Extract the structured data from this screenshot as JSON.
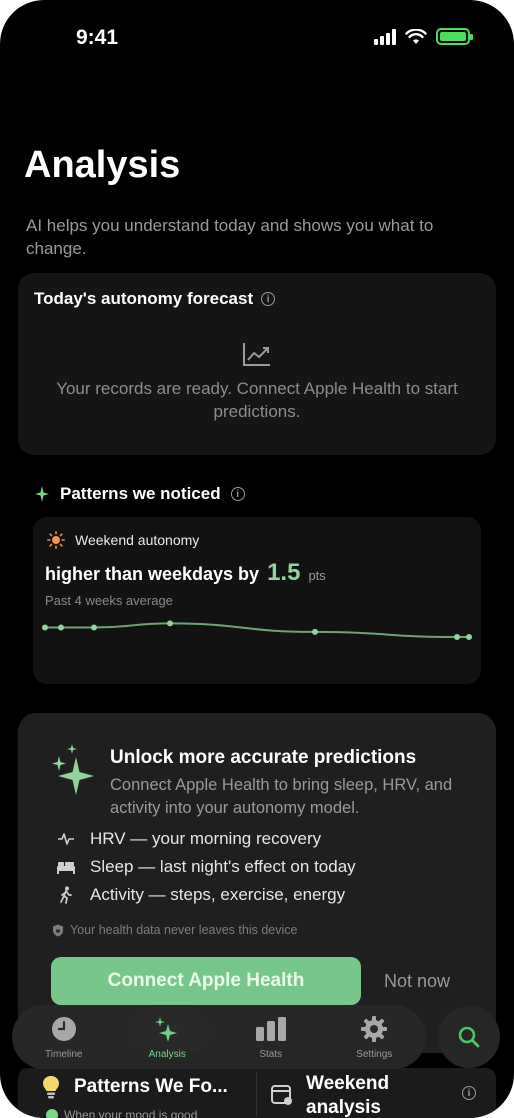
{
  "status_bar": {
    "time": "9:41"
  },
  "header": {
    "title": "Analysis",
    "subtitle": "AI helps you understand today and shows you what to change."
  },
  "forecast_card": {
    "title": "Today's autonomy forecast",
    "message": "Your records are ready. Connect Apple Health to start predictions."
  },
  "patterns": {
    "header": "Patterns we noticed",
    "card": {
      "tag": "Weekend autonomy",
      "statement": "higher than weekdays by",
      "value": "1.5",
      "unit": "pts",
      "caption": "Past 4 weeks average",
      "trend_values": [
        0.56,
        0.56,
        0.56,
        0.8,
        0.3,
        0.0,
        0.0
      ]
    }
  },
  "unlock_card": {
    "title": "Unlock more accurate predictions",
    "description": "Connect Apple Health to bring sleep, HRV, and activity into your autonomy model.",
    "features": [
      {
        "icon": "heartbeat-icon",
        "label": "HRV — your morning recovery"
      },
      {
        "icon": "bed-icon",
        "label": "Sleep — last night's effect on today"
      },
      {
        "icon": "walking-icon",
        "label": "Activity — steps, exercise, energy"
      }
    ],
    "privacy_note": "Your health data never leaves this device",
    "primary_button": "Connect Apple Health",
    "secondary_button": "Not now"
  },
  "tab_bar": {
    "tabs": [
      {
        "label": "Timeline",
        "icon": "clock-icon"
      },
      {
        "label": "Analysis",
        "icon": "sparkle-icon",
        "active": true
      },
      {
        "label": "Stats",
        "icon": "bar-chart-icon"
      },
      {
        "label": "Settings",
        "icon": "gear-icon"
      }
    ]
  },
  "bottom_strip": {
    "left_title": "Patterns We Fo...",
    "left_sub": "When your mood is good",
    "right_title": "Weekend analysis"
  },
  "colors": {
    "accent": "#78c78a",
    "accent_text": "#8fd49a",
    "background": "#000000",
    "card": "#151515"
  }
}
